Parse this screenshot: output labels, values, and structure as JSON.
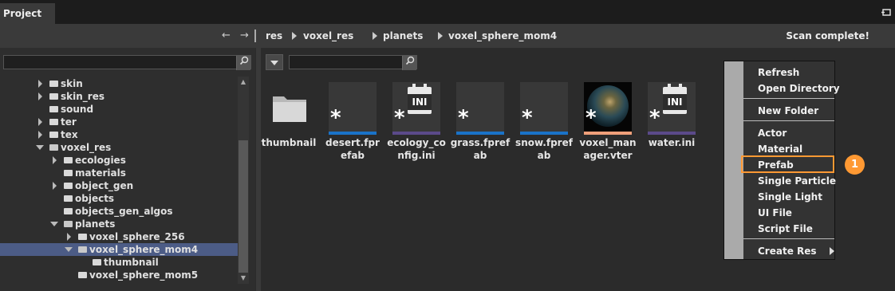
{
  "window": {
    "tab_title": "Project"
  },
  "toolbar": {
    "back": "←",
    "forward": "→",
    "breadcrumb": [
      "res",
      "voxel_res",
      "planets",
      "voxel_sphere_mom4"
    ],
    "status": "Scan complete!"
  },
  "tree": {
    "search_value": "",
    "items": [
      {
        "label": "skin",
        "expander": "collapsed"
      },
      {
        "label": "skin_res",
        "expander": "collapsed"
      },
      {
        "label": "sound",
        "expander": "none"
      },
      {
        "label": "ter",
        "expander": "collapsed"
      },
      {
        "label": "tex",
        "expander": "collapsed"
      },
      {
        "label": "voxel_res",
        "expander": "expanded"
      },
      {
        "label": "ecologies",
        "expander": "collapsed"
      },
      {
        "label": "materials",
        "expander": "none"
      },
      {
        "label": "object_gen",
        "expander": "collapsed"
      },
      {
        "label": "objects",
        "expander": "none"
      },
      {
        "label": "objects_gen_algos",
        "expander": "none"
      },
      {
        "label": "planets",
        "expander": "expanded"
      },
      {
        "label": "voxel_sphere_256",
        "expander": "collapsed"
      },
      {
        "label": "voxel_sphere_mom4",
        "expander": "expanded",
        "selected": true
      },
      {
        "label": "thumbnail",
        "expander": "none"
      },
      {
        "label": "voxel_sphere_mom5",
        "expander": "none"
      }
    ]
  },
  "files": {
    "search_value": "",
    "items": [
      {
        "label": "thumbnail",
        "kind": "folder"
      },
      {
        "label": "desert.fprefab",
        "kind": "prefab",
        "bar_color": "#1a73c8"
      },
      {
        "label": "ecology_config.ini",
        "kind": "ini",
        "bar_color": "#5b4a8a"
      },
      {
        "label": "grass.fprefab",
        "kind": "prefab",
        "bar_color": "#1a73c8"
      },
      {
        "label": "snow.fprefab",
        "kind": "prefab",
        "bar_color": "#1a73c8"
      },
      {
        "label": "voxel_manager.vter",
        "kind": "vter",
        "bar_color": "#f0a07a"
      },
      {
        "label": "water.ini",
        "kind": "ini",
        "bar_color": "#5b4a8a"
      }
    ],
    "ini_label": "INI",
    "star": "*"
  },
  "context_menu": {
    "items": [
      "Refresh",
      "Open Directory",
      "New Folder",
      "Actor",
      "Material",
      "Prefab",
      "Single Particle",
      "Single Light",
      "UI File",
      "Script File",
      "Create Res"
    ],
    "highlighted": "Prefab"
  },
  "annotation": {
    "badge": "1",
    "color": "#ff9933"
  }
}
